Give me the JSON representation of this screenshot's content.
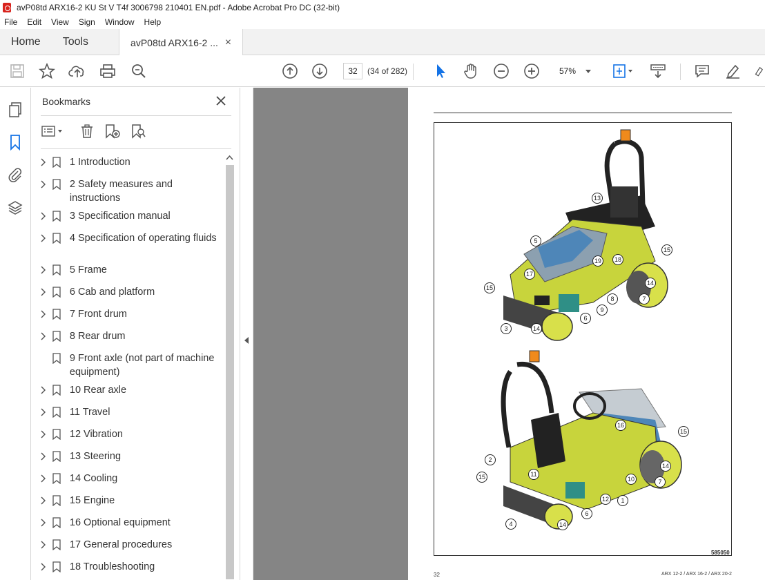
{
  "window": {
    "title": "avP08td ARX16-2 KU St V T4f 3006798 210401 EN.pdf - Adobe Acrobat Pro DC (32-bit)"
  },
  "menu": [
    "File",
    "Edit",
    "View",
    "Sign",
    "Window",
    "Help"
  ],
  "tabs": {
    "home": "Home",
    "tools": "Tools",
    "doc": "avP08td ARX16-2 ...",
    "close": "×"
  },
  "toolbar": {
    "page_value": "32",
    "page_count": "(34 of 282)",
    "zoom": "57%"
  },
  "bookmarks": {
    "title": "Bookmarks",
    "items": [
      {
        "label": "1 Introduction",
        "expandable": true
      },
      {
        "label": "2 Safety measures and instructions",
        "expandable": true
      },
      {
        "label": "3 Specification manual",
        "expandable": true
      },
      {
        "label": "4 Specification of operating fluids",
        "expandable": true
      },
      {
        "label": "5 Frame",
        "expandable": true
      },
      {
        "label": "6 Cab and platform",
        "expandable": true
      },
      {
        "label": "7 Front drum",
        "expandable": true
      },
      {
        "label": "8 Rear drum",
        "expandable": true
      },
      {
        "label": "9 Front axle (not part of machine equipment)",
        "expandable": false
      },
      {
        "label": "10 Rear axle",
        "expandable": true
      },
      {
        "label": "11 Travel",
        "expandable": true
      },
      {
        "label": "12 Vibration",
        "expandable": true
      },
      {
        "label": "13 Steering",
        "expandable": true
      },
      {
        "label": "14 Cooling",
        "expandable": true
      },
      {
        "label": "15 Engine",
        "expandable": true
      },
      {
        "label": "16 Optional equipment",
        "expandable": true
      },
      {
        "label": "17 General procedures",
        "expandable": true
      },
      {
        "label": "18 Troubleshooting",
        "expandable": true
      }
    ]
  },
  "document": {
    "figure_id": "585050",
    "footer_left": "32",
    "footer_right": "ARX 12-2 / ARX 16-2 / ARX 20-2",
    "callouts_top": [
      "13",
      "5",
      "19",
      "18",
      "15",
      "17",
      "14",
      "15",
      "8",
      "7",
      "9",
      "6",
      "3",
      "14"
    ],
    "callouts_bottom": [
      "16",
      "15",
      "2",
      "14",
      "11",
      "15",
      "10",
      "7",
      "12",
      "1",
      "6",
      "4",
      "14"
    ]
  }
}
